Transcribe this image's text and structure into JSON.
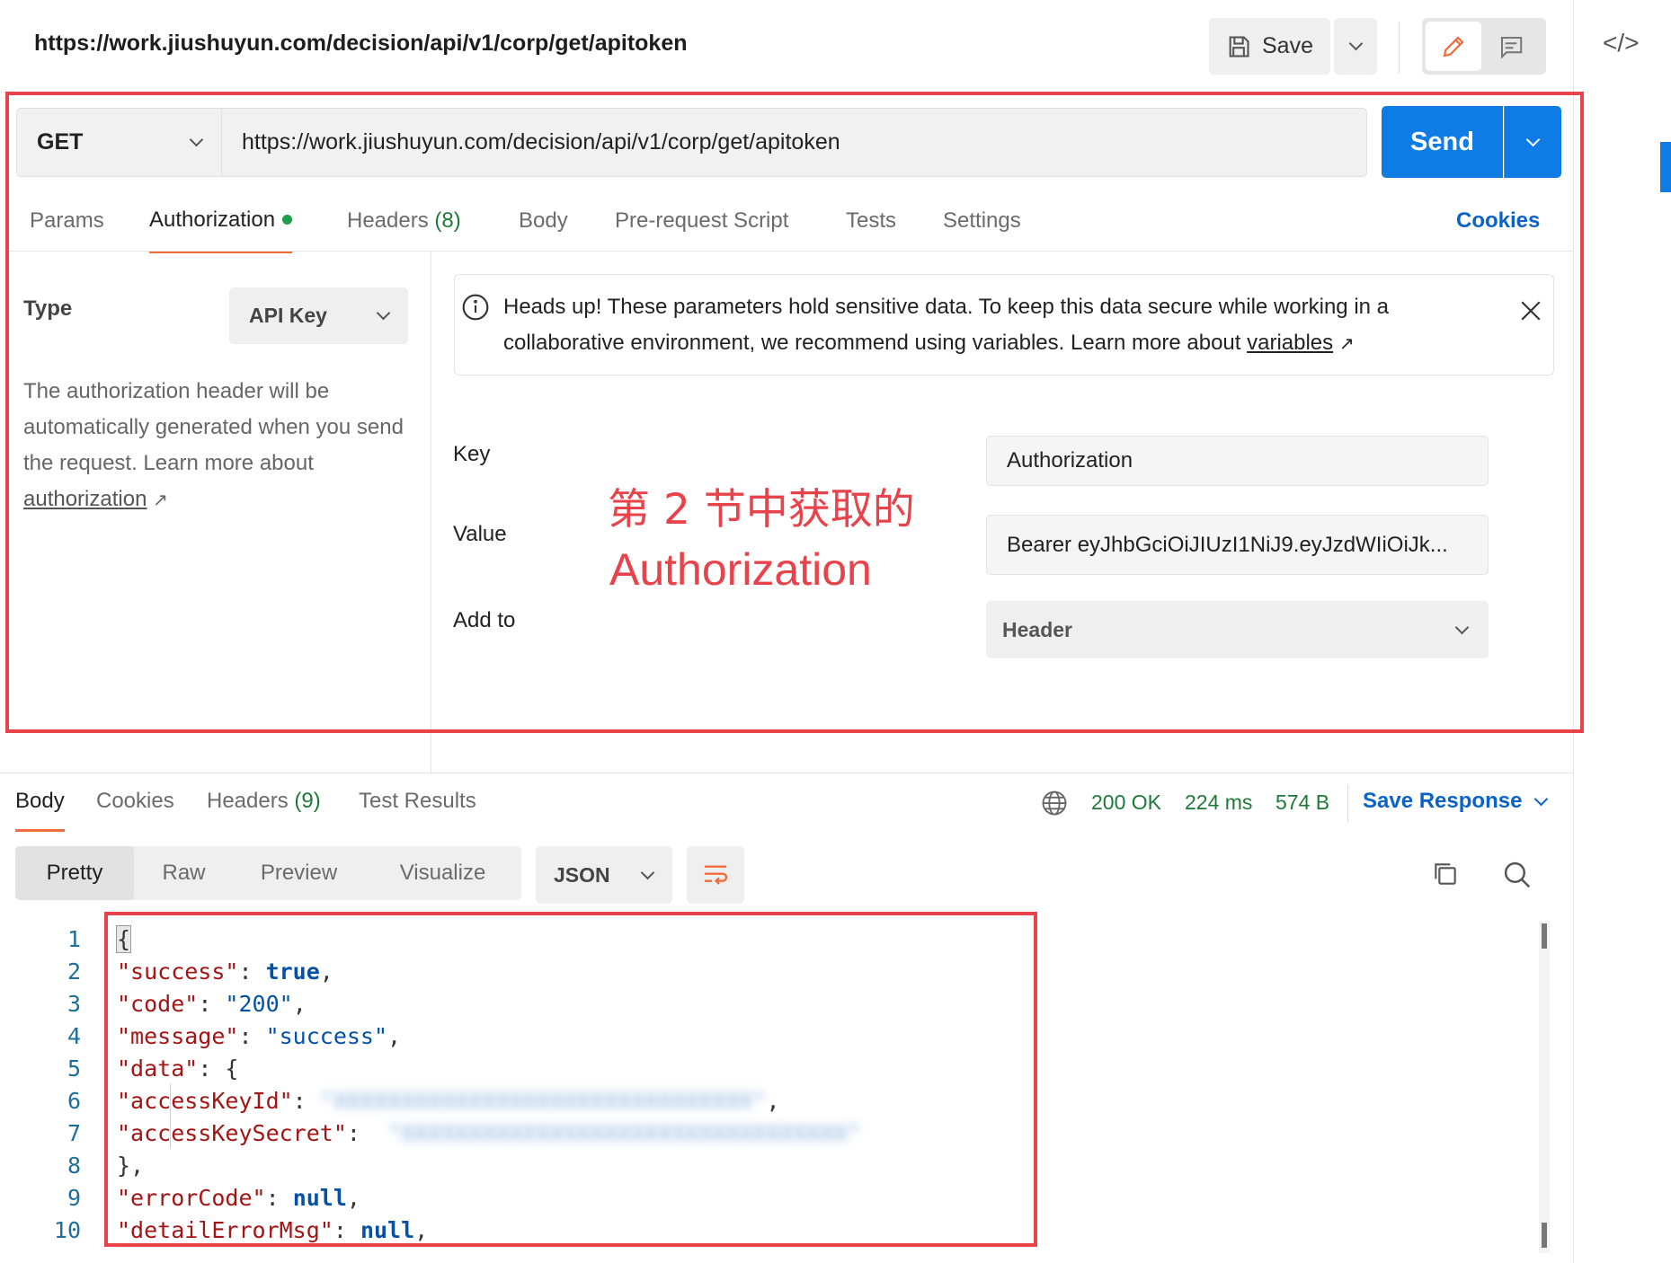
{
  "header": {
    "title": "https://work.jiushuyun.com/decision/api/v1/corp/get/apitoken",
    "save_label": "Save"
  },
  "request": {
    "method": "GET",
    "url": "https://work.jiushuyun.com/decision/api/v1/corp/get/apitoken",
    "send_label": "Send",
    "tabs": [
      {
        "label": "Params"
      },
      {
        "label": "Authorization"
      },
      {
        "label": "Headers",
        "count": "(8)"
      },
      {
        "label": "Body"
      },
      {
        "label": "Pre-request Script"
      },
      {
        "label": "Tests"
      },
      {
        "label": "Settings"
      }
    ],
    "cookies_label": "Cookies"
  },
  "auth": {
    "type_label": "Type",
    "type_value": "API Key",
    "description": "The authorization header will be automatically generated when you send the request. Learn more about",
    "description_link": "authorization",
    "notice_text": "Heads up! These parameters hold sensitive data. To keep this data secure while working in a collaborative environment, we recommend using variables. Learn more about",
    "notice_link": "variables",
    "key_label": "Key",
    "key_value": "Authorization",
    "value_label": "Value",
    "value_value": "Bearer eyJhbGciOiJIUzI1NiJ9.eyJzdWIiOiJk...",
    "addto_label": "Add to",
    "addto_value": "Header",
    "annotation_line1": "第 2 节中获取的",
    "annotation_line2": "Authorization"
  },
  "response": {
    "tabs": [
      {
        "label": "Body"
      },
      {
        "label": "Cookies"
      },
      {
        "label": "Headers",
        "count": "(9)"
      },
      {
        "label": "Test Results"
      }
    ],
    "status": "200 OK",
    "time": "224 ms",
    "size": "574 B",
    "save_response_label": "Save Response",
    "view_modes": [
      "Pretty",
      "Raw",
      "Preview",
      "Visualize"
    ],
    "format": "JSON",
    "line_numbers": [
      "1",
      "2",
      "3",
      "4",
      "5",
      "6",
      "7",
      "8",
      "9",
      "10"
    ],
    "code": {
      "open_brace": "{",
      "success_key": "\"success\"",
      "success_val": "true",
      "code_key": "\"code\"",
      "code_val": "\"200\"",
      "message_key": "\"message\"",
      "message_val": "\"success\"",
      "data_key": "\"data\"",
      "access_key_id_key": "\"accessKeyId\"",
      "access_key_secret_key": "\"accessKeySecret\"",
      "close_data": "},",
      "error_code_key": "\"errorCode\"",
      "error_code_val": "null",
      "detail_key": "\"detailErrorMsg\"",
      "detail_val": "null"
    }
  },
  "colors": {
    "accent": "#f26b3a",
    "send_blue": "#0f7ce6",
    "link_blue": "#0b63c9",
    "status_green": "#1f7a3a",
    "highlight_red": "#e8424a"
  }
}
